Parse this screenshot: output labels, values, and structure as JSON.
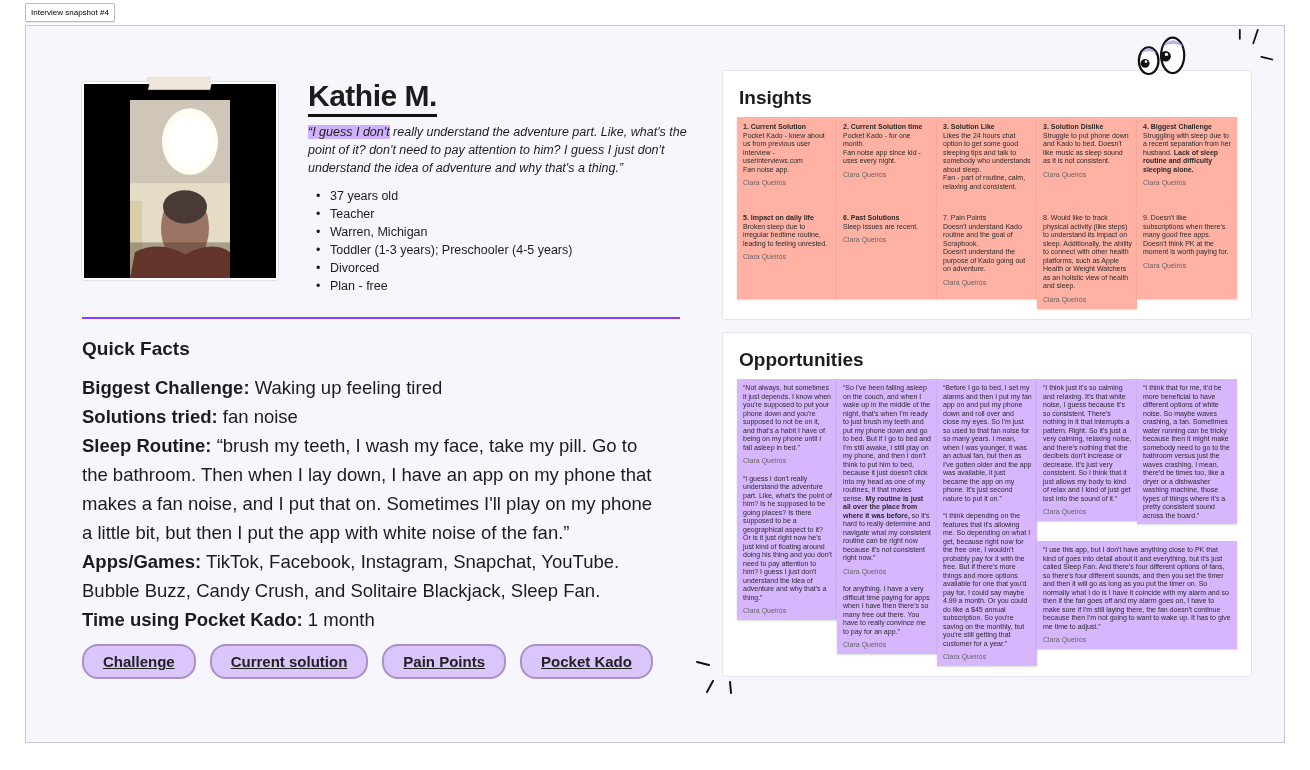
{
  "tab": {
    "label": "Interview snapshot #4"
  },
  "profile": {
    "name": "Kathie M.",
    "quote_highlight": "“I guess I don't",
    "quote_rest": " really understand the adventure part. Like, what's the point of it? don't need to pay attention to him? I guess I just don't understand the idea of adventure and why that's a thing.”",
    "facts": [
      {
        "bullet": "•",
        "text": "37 years old"
      },
      {
        "bullet": "•",
        "text": "Teacher"
      },
      {
        "bullet": "•",
        "text": "Warren, Michigan"
      },
      {
        "bullet": "•",
        "text": "Toddler (1-3 years); Preschooler (4-5 years)"
      },
      {
        "bullet": "•",
        "text": "Divorced"
      },
      {
        "bullet": "•",
        "text": "Plan - free"
      }
    ]
  },
  "quick_facts": {
    "title": "Quick Facts",
    "items": [
      "**Biggest Challenge:** Waking up feeling tired",
      "**Solutions tried:** fan noise",
      "**Sleep Routine:**  “brush my teeth, I wash my face, take my pill. Go to the bathroom. Then when I lay down, I have an app on my phone that makes a fan noise, and I put that on. Sometimes I'll play on my phone a little bit, but then I put the app with white noise of the fan.”",
      "**Apps/Games:** TikTok, Facebook, Instagram, Snapchat, YouTube. Bubble Buzz, Candy Crush, and Solitaire Blackjack, Sleep Fan.",
      "**Time using Pocket Kado:** 1 month"
    ]
  },
  "tags": [
    "Challenge",
    "Current solution",
    "Pain Points",
    "Pocket Kado"
  ],
  "insights": {
    "title": "Insights",
    "notes": [
      {
        "title": "1. Current Solution",
        "bold_title": true,
        "lines": [
          "Pocket Kado - knew about us from previous user interview - userinterviews.com",
          "Fan noise app."
        ],
        "author": "Clara Queirós"
      },
      {
        "title": "2. Current Solution time",
        "bold_title": true,
        "lines": [
          "Pocket Kado - for one month.",
          "Fan noise app since kid - uses every night."
        ],
        "author": "Clara Queirós"
      },
      {
        "title": "3. Solution Like",
        "bold_title": true,
        "lines": [
          "Likes the 24 hours chat option to get some good sleeping tips and talk to somebody who understands about sleep.",
          "Fan - part of routine, calm, relaxing and consistent."
        ]
      },
      {
        "title": "3. Solution Dislike",
        "bold_title": true,
        "lines": [
          "Struggle to put phone down and Kado to bed. Doesn't like music as sleep sound as it is not consistent."
        ],
        "author": "Clara Queirós"
      },
      {
        "title": "4. Biggest Challenge",
        "bold_title": true,
        "lines": [
          "Struggling with sleep due to a recent separation from her husband. **Lack of sleep routine and difficulty sleeping alone.**"
        ],
        "author": "Clara Queirós"
      },
      {
        "title": "5. Impact on daily life",
        "bold_title": true,
        "lines": [
          "Broken sleep due to irregular bedtime routine, leading to feeling unrested."
        ],
        "author": "Clara Queirós"
      },
      {
        "title": "6. Past Solutions",
        "bold_title": true,
        "lines": [
          "Sleep issues are recent."
        ],
        "author": "Clara Queirós"
      },
      {
        "title": "7. Pain Points",
        "bold_title": false,
        "lines": [
          "Doesn't understand Kado routine and the goal of Scrapbook.",
          "Doesn't understand the purpose of Kado going out on adventure."
        ],
        "author": "Clara Queirós"
      },
      {
        "title": "8. Would like to track",
        "bold_title": false,
        "lines": [
          "physical activity (like steps) to understand its impact on sleep. Additionally, the ability to connect with other health platforms, such as Apple Health or Weight Watchers as an holistic view of health and sleep."
        ],
        "author": "Clara Queirós"
      },
      {
        "title": "9. Doesn't like",
        "bold_title": false,
        "lines": [
          "subscriptions when there's many good free apps. Doesn't think PK at the moment is worth paying for."
        ],
        "author": "Clara Queirós"
      }
    ]
  },
  "opportunities": {
    "title": "Opportunities",
    "stacks": [
      [
        {
          "text": "“Not always, but sometimes it just depends. I know when you're supposed to put your phone down and you're supposed to not be on it, and that's a habit I have of being on my phone until I fall asleep in bed.”",
          "author": "Clara Queirós"
        },
        {
          "text": "“I guess I don't really understand the adventure part. Like, what's the point of him? Is he supposed to be going places? Is there supposed to be a geographical aspect to it? Or is it just right now he's just kind of floating around doing his thing and you don't need to pay attention to him? I guess I just don't understand the idea of adventure and why that's a thing.”",
          "author": "Clara Queirós"
        }
      ],
      [
        {
          "text": "“So I've been falling asleep on the couch, and when I wake up in the middle of the night, that's when I'm ready to just brush my teeth and put my phone down and go to bed. But if I go to bed and I'm still awake, I still play on my phone, and then I don't think to put him to bed, because it just doesn't click into my head as one of my routines, if that makes sense. **My routine is just all over the place from where it was before,** so it's hard to really determine and navigate what my consistent routine can be right now because it's not consistent right now.”",
          "author": "Clara Queirós"
        },
        {
          "text": "for anything. I have a very difficult time paying for apps when I have then there's so many free out there. You have to really convince me to pay for an app.”",
          "author": "Clara Queirós"
        }
      ],
      [
        {
          "text": "“Before I go to bed, I set my alarms and then I put my fan app on and put my phone down and roll over and close my eyes. So I'm just so used to that fan noise for so many years. I mean, when I was younger, it was an actual fan, but then as I've gotten older and the app was available, it just became the app on my phone. It's just second nature to put it on.”"
        },
        {
          "text": "“I think depending on the features that it's allowing me. So depending on what I get, because right now for the free one, I wouldn't probably pay for it with the free. But if there's more things and more options available for one that you'd pay for, I could say maybe 4.99 a month. Or you could do like a $45 annual subscription. So you're saving on the monthly, but you're still getting that customer for a year.”",
          "author": "Clara Queirós"
        }
      ]
    ],
    "top_pair": [
      {
        "text": "“I think just it's so calming and relaxing. It's that white noise, I guess because it's so consistent. There's nothing in it that interrupts a pattern. Right. So it's just a very calming, relaxing noise, and there's nothing that the decibels don't increase or decrease. It's just very consistent. So I think that it just allows my body to kind of relax and I kind of just get lost into the sound of it.”",
        "author": "Clara Queirós"
      },
      {
        "text": "“I think that for me, it'd be more beneficial to have different options of white noise. So maybe waves crashing, a fan. Sometimes water running can be tricky because then it might make somebody need to go to the bathroom versus just the waves crashing. I mean, there'd be times too, like a dryer or a dishwasher washing machine, those types of things where it's a pretty consistent sound across the board.”"
      }
    ],
    "wide_note": {
      "text": "“I use this app, but I don't have anything close to PK that kind of goes into detail about it and everything, but it's just called Sleep Fan. And there's four different options of fans, so there's four different sounds, and then you set the timer and then it will go as long as you put the timer on. So normally what I do is I have it coincide with my alarm and so then if the fan goes off and my alarm goes on, I have to make sure if I'm still laying there, the fan doesn't continue because then I'm not going to want to wake up. It has to give me time to adjust.”",
      "author": "Clara Queirós"
    }
  }
}
